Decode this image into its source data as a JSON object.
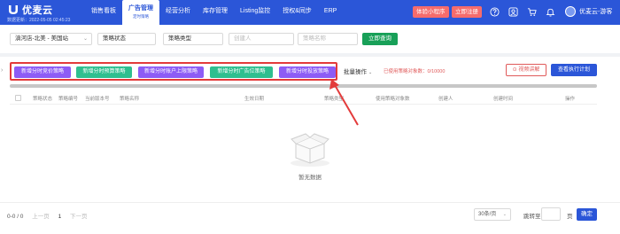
{
  "colors": {
    "brand": "#2b56d8",
    "danger": "#f56c6c",
    "purple": "#8d5cf5",
    "teal": "#2fbf8f",
    "success": "#18a058",
    "annotation": "#e33b3b"
  },
  "header": {
    "logo_text": "优麦云",
    "sync_time": "数据更新：2022-05-05 02:45:23",
    "nav": [
      {
        "label": "销售看板"
      },
      {
        "label": "广告管理",
        "sub": "定时策略"
      },
      {
        "label": "经营分析"
      },
      {
        "label": "库存管理"
      },
      {
        "label": "Listing监控"
      },
      {
        "label": "授权&同步"
      },
      {
        "label": "ERP"
      }
    ],
    "mini_program": "体验小程序",
    "register": "立即注册",
    "icons": [
      "help-icon",
      "user-center-icon",
      "cart-icon",
      "bell-icon"
    ],
    "username": "优麦云-游客"
  },
  "filters": {
    "shop": "滇河店-北美 - 美国站",
    "status": "策略状态",
    "type": "策略类型",
    "creator_placeholder": "创建人",
    "name_placeholder": "策略名称",
    "query": "立即查询"
  },
  "toolbar": {
    "buttons": [
      {
        "label": "新增分时竞价策略",
        "color": "purple"
      },
      {
        "label": "新增分时预算策略",
        "color": "teal"
      },
      {
        "label": "新增分时账户上限策略",
        "color": "purple"
      },
      {
        "label": "新增分时广告位策略",
        "color": "teal"
      },
      {
        "label": "新增分时投放策略",
        "color": "purple"
      }
    ],
    "batch": "批量操作",
    "used": "已使用策略对象数：0/10000",
    "tips": "视频讲解",
    "plan": "查看执行计划"
  },
  "table": {
    "columns": [
      "策略状态",
      "策略编号",
      "当前版本号",
      "策略名称",
      "生效日期",
      "策略类型",
      "使用策略对象数",
      "创建人",
      "创建时间",
      "操作"
    ],
    "rows": [],
    "empty": "暂无数据"
  },
  "pager": {
    "range": "0-0 / 0",
    "prev": "上一页",
    "page": "1",
    "next": "下一页",
    "page_size": "30条/页",
    "goto": "跳转至",
    "page_unit": "页",
    "confirm": "确定"
  }
}
